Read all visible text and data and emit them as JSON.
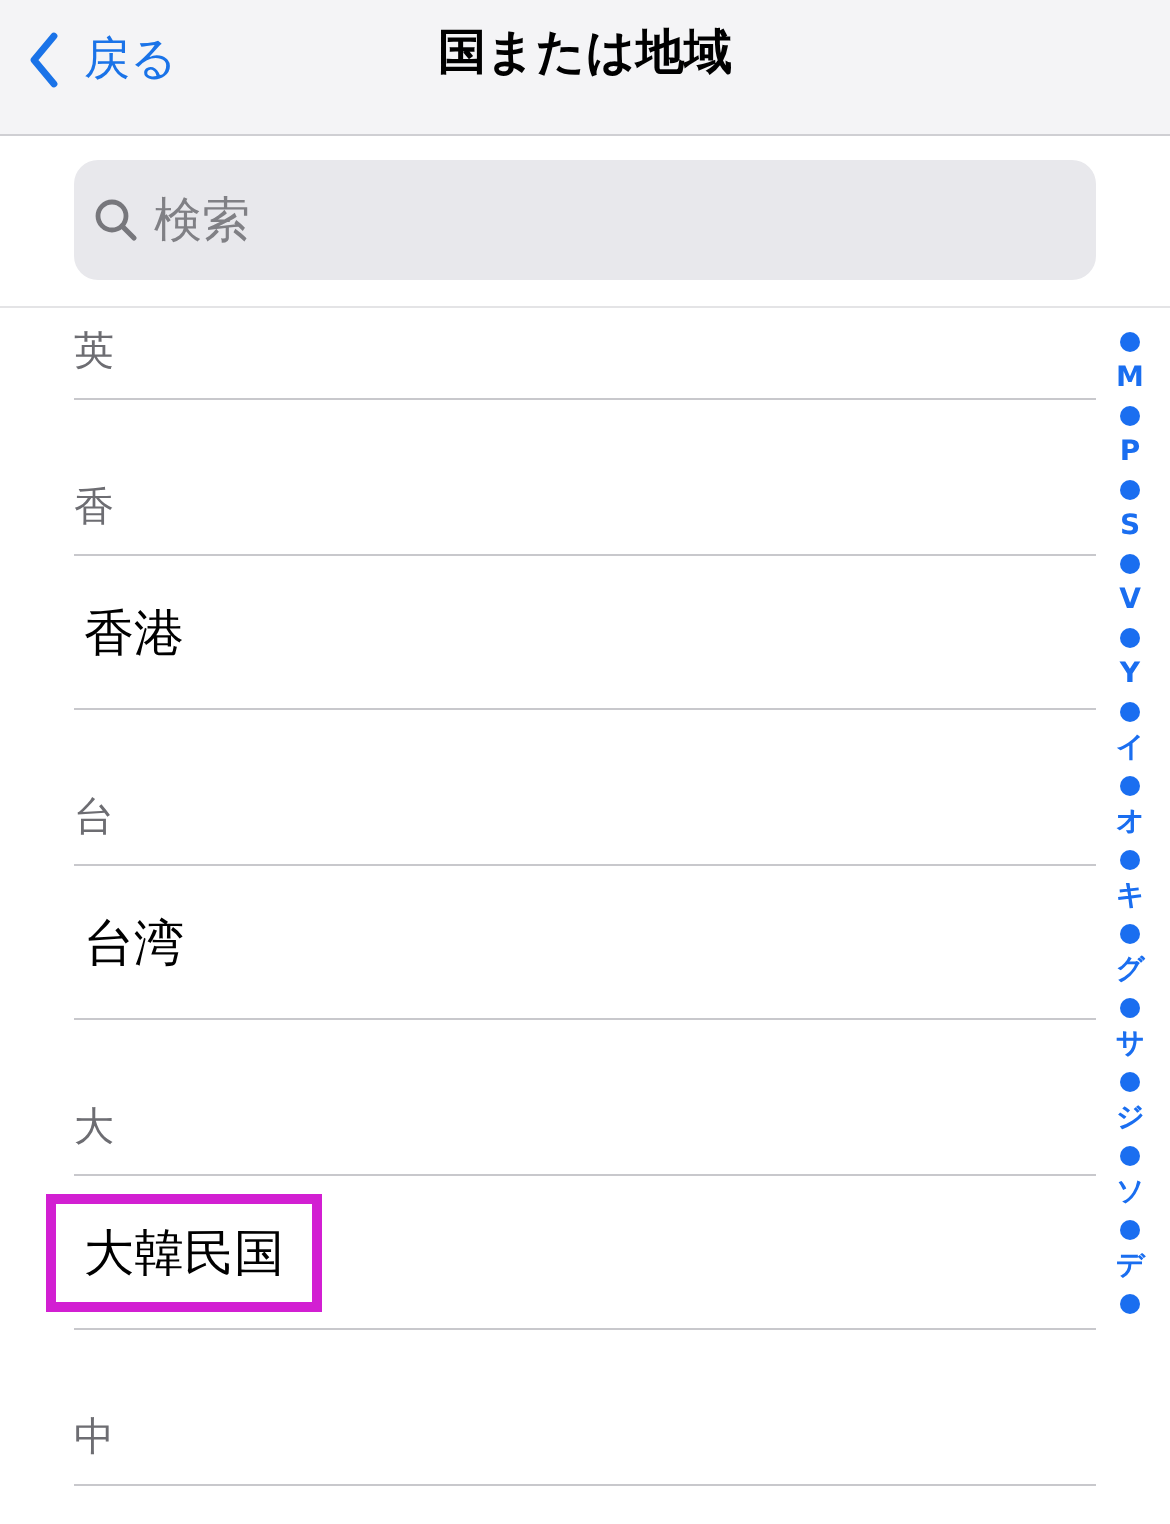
{
  "nav": {
    "back": "戻る",
    "title": "国または地域"
  },
  "search": {
    "placeholder": "検索"
  },
  "list": [
    {
      "kind": "header",
      "label": "英"
    },
    {
      "kind": "header",
      "label": "香"
    },
    {
      "kind": "item",
      "label": "香港",
      "highlighted": false
    },
    {
      "kind": "header",
      "label": "台"
    },
    {
      "kind": "item",
      "label": "台湾",
      "highlighted": false
    },
    {
      "kind": "header",
      "label": "大"
    },
    {
      "kind": "item",
      "label": "大韓民国",
      "highlighted": true
    },
    {
      "kind": "header",
      "label": "中"
    }
  ],
  "index": [
    "M",
    "P",
    "S",
    "V",
    "Y",
    "イ",
    "オ",
    "キ",
    "グ",
    "サ",
    "ジ",
    "ソ",
    "デ"
  ]
}
